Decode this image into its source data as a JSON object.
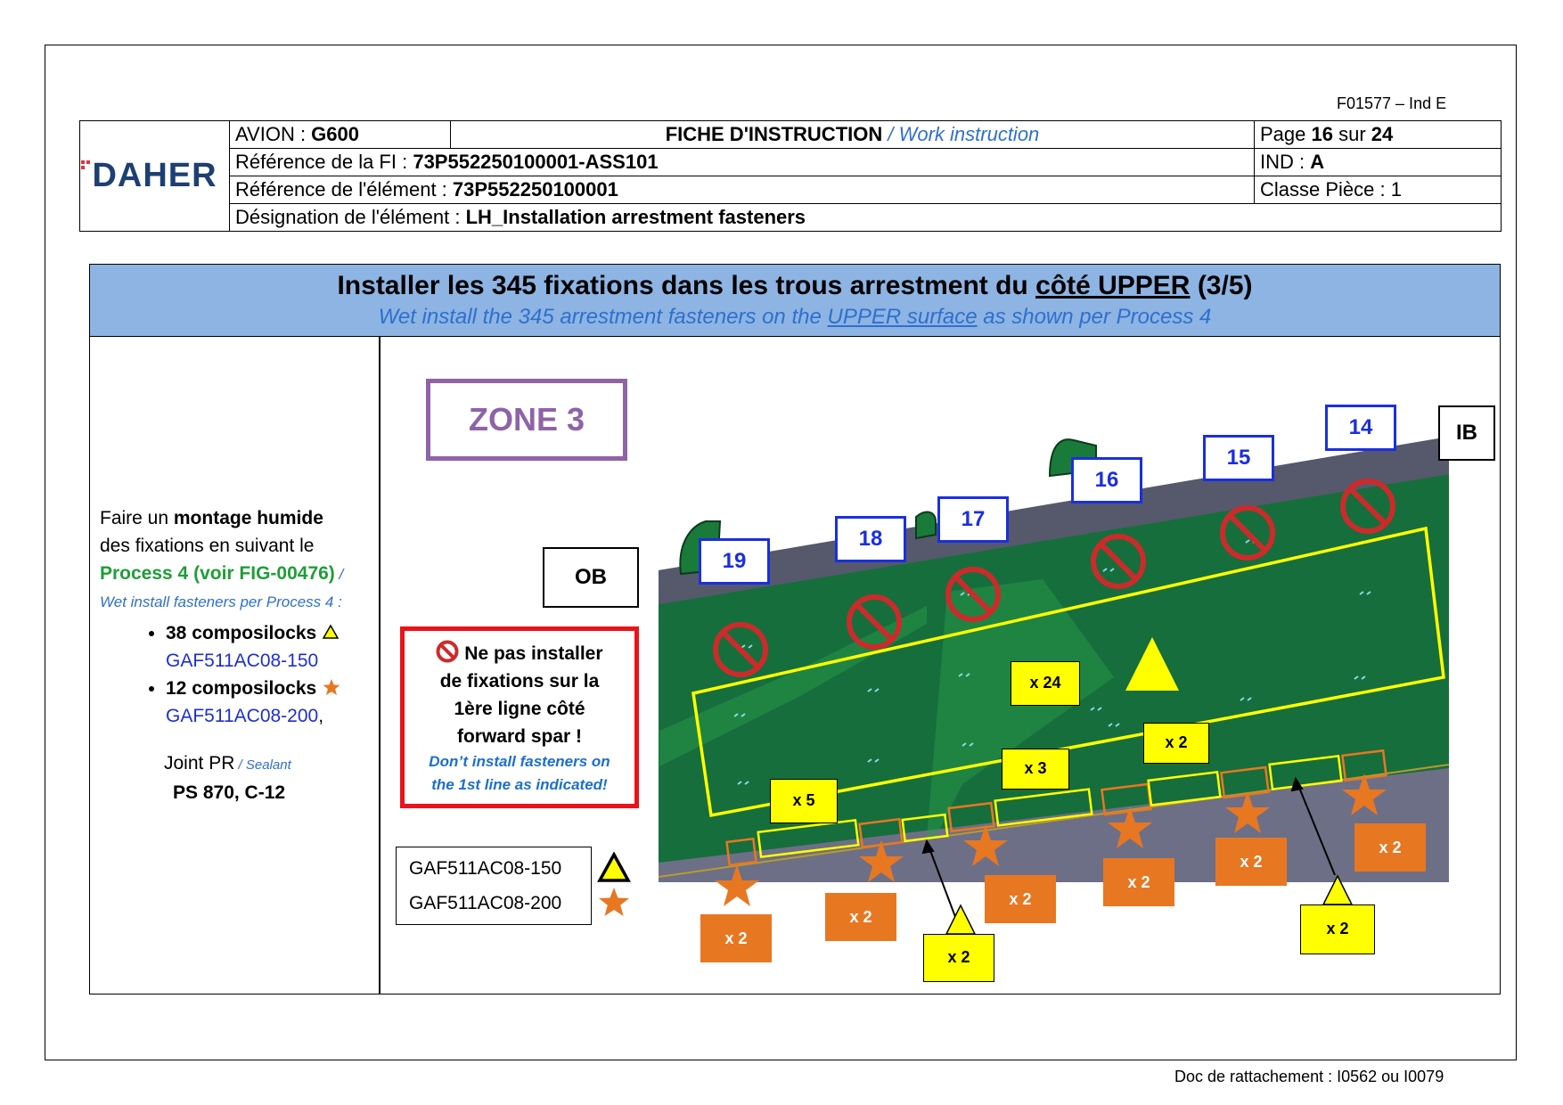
{
  "form_code": "F01577 – Ind E",
  "header": {
    "logo_text": "DAHER",
    "avion_label": "AVION : ",
    "avion_value": "G600",
    "doc_type": "FICHE D'INSTRUCTION",
    "doc_type_en": " / Work instruction",
    "page_label": "Page ",
    "page_current": "16",
    "page_sep": " sur ",
    "page_total": "24",
    "fi_ref_label": "Référence de la FI : ",
    "fi_ref_value": "73P552250100001-ASS101",
    "ind_label": "IND : ",
    "ind_value": "A",
    "elem_ref_label": "Référence de l'élément : ",
    "elem_ref_value": "73P552250100001",
    "class_label": "Classe Pièce : 1",
    "designation_label": "Désignation de l'élément : ",
    "designation_value": "LH_Installation arrestment fasteners"
  },
  "title": {
    "fr_main": "Installer les 345 fixations dans les trous arrestment du ",
    "fr_underlined": "côté UPPER",
    "fr_end": " (3/5)",
    "en_start": "Wet install the 345 arrestment fasteners on the ",
    "en_underlined": "UPPER surface",
    "en_end": " as shown per Process 4"
  },
  "instructions": {
    "line1_start": "Faire un ",
    "line1_bold": "montage humide",
    "line2": "des fixations en suivant le",
    "process": "Process 4 (voir FIG-00476)",
    "process_sep": " /",
    "process_en": "Wet install fasteners per Process 4 :",
    "items": [
      {
        "count": "38 composilocks",
        "ref": "GAF511AC08-150",
        "marker": "triangle",
        "trail": ""
      },
      {
        "count": "12 composilocks",
        "ref": "GAF511AC08-200",
        "marker": "star",
        "trail": ","
      }
    ],
    "sealant_label": "Joint PR",
    "sealant_en": " / Sealant",
    "sealant_value": "PS 870, C-12"
  },
  "zone": "ZONE 3",
  "labels": {
    "ob": "OB",
    "ib": "IB"
  },
  "hole_numbers": [
    "19",
    "18",
    "17",
    "16",
    "15",
    "14"
  ],
  "warning": {
    "fr_line1": "Ne pas installer",
    "fr_line2": "de fixations sur la",
    "fr_line3": "1ère ligne côté",
    "fr_line4": "forward spar !",
    "en_line1": "Don’t install fasteners on",
    "en_line2": "the 1st line as indicated!"
  },
  "legend": [
    {
      "ref": "GAF511AC08-150",
      "marker": "triangle"
    },
    {
      "ref": "GAF511AC08-200",
      "marker": "star"
    }
  ],
  "quantity_tags": {
    "yellow": [
      "x 24",
      "x 2",
      "x 3",
      "x 5",
      "x 2",
      "x 2"
    ],
    "orange": [
      "x 2",
      "x 2",
      "x 2",
      "x 2",
      "x 2",
      "x 2"
    ]
  },
  "colors": {
    "accent_blue": "#2f6fce",
    "title_band": "#8db4e2",
    "zone_purple": "#8e63a8",
    "warning_red": "#e8141a",
    "part_green": "#1a7a3a",
    "marker_yellow": "#ffff00",
    "marker_orange": "#e87722"
  },
  "footer": "Doc de rattachement : I0562 ou I0079"
}
